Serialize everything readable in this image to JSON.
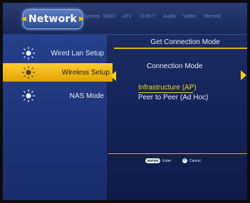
{
  "tabs": {
    "active": "Network",
    "others": [
      "System",
      "MISC",
      "ATV",
      "DVB-T",
      "Audio",
      "Video",
      "Record"
    ]
  },
  "menu": {
    "items": [
      {
        "label": "Wired Lan Setup",
        "icon": "sun-icon"
      },
      {
        "label": "Wireless Setup",
        "icon": "sun-icon",
        "selected": true
      },
      {
        "label": "NAS Mode",
        "icon": "sun-icon"
      }
    ]
  },
  "panel": {
    "title": "Get Connection Mode",
    "connection_label": "Connection Mode",
    "options": [
      {
        "label": "Infrastructure (AP)",
        "selected": true
      },
      {
        "label": "Peer to Peer (Ad Hoc)"
      }
    ]
  },
  "hints": {
    "enter_key": "ENTER",
    "enter_label": "Enter",
    "cancel_label": "Cancel"
  },
  "colors": {
    "accent": "#f5d21b",
    "selection": "#ffcc33"
  }
}
